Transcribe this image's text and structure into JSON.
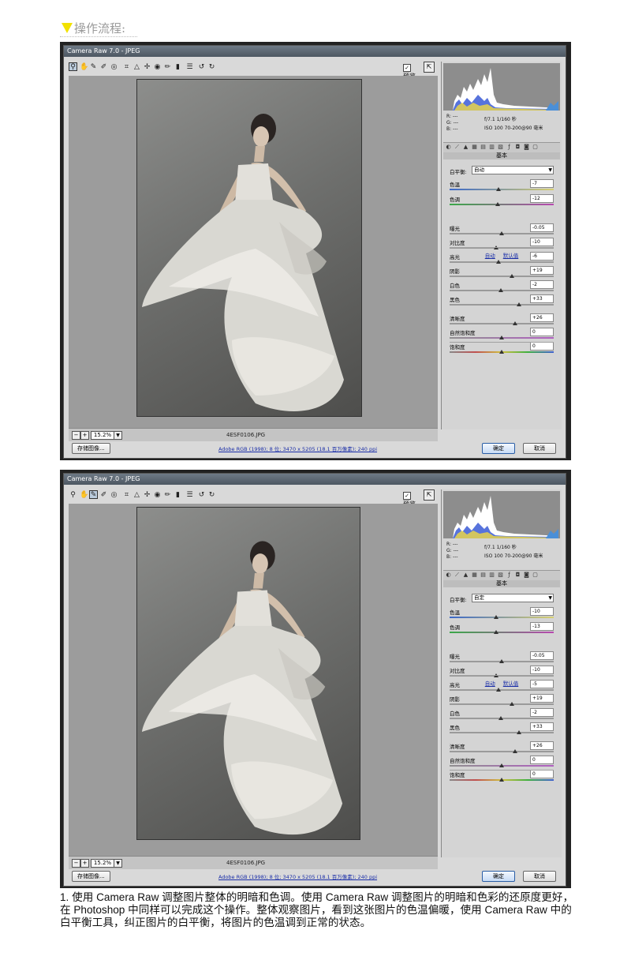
{
  "heading": "操作流程:",
  "screenshots": [
    {
      "title": "Camera Raw 7.0 - JPEG",
      "preview_label": "预览",
      "zoom": "15.2%",
      "filename": "4ESF0106.JPG",
      "workflow_link": "Adobe RGB (1998); 8 位; 3470 x 5205 (18.1 百万像素); 240 ppi",
      "save_button": "存储图像...",
      "ok_button": "确定",
      "cancel_button": "取消",
      "readout_r": "R:  ---",
      "readout_g": "G:  ---",
      "readout_b": "B:  ---",
      "camera_line1": "f/7.1   1/160 秒",
      "camera_line2": "ISO 100   70-200@90 毫米",
      "section": "基本",
      "wb_label": "白平衡:",
      "wb_value": "自动",
      "auto_link": "自动",
      "default_link": "默认值",
      "sliders": [
        {
          "label": "色温",
          "value": "-7",
          "level": 0.47
        },
        {
          "label": "色调",
          "value": "-12",
          "level": 0.46
        },
        {
          "label": "曝光",
          "value": "-0.05",
          "level": 0.5
        },
        {
          "label": "对比度",
          "value": "-10",
          "level": 0.45
        },
        {
          "label": "高光",
          "value": "-6",
          "level": 0.47
        },
        {
          "label": "阴影",
          "value": "+19",
          "level": 0.6
        },
        {
          "label": "白色",
          "value": "-2",
          "level": 0.49
        },
        {
          "label": "黑色",
          "value": "+33",
          "level": 0.67
        },
        {
          "label": "清晰度",
          "value": "+26",
          "level": 0.63
        },
        {
          "label": "自然饱和度",
          "value": "0",
          "level": 0.5
        },
        {
          "label": "饱和度",
          "value": "0",
          "level": 0.5
        }
      ]
    },
    {
      "title": "Camera Raw 7.0 - JPEG",
      "preview_label": "预览",
      "zoom": "15.2%",
      "filename": "4ESF0106.JPG",
      "workflow_link": "Adobe RGB (1998); 8 位; 3470 x 5205 (18.1 百万像素); 240 ppi",
      "save_button": "存储图像...",
      "ok_button": "确定",
      "cancel_button": "取消",
      "readout_r": "R:  ---",
      "readout_g": "G:  ---",
      "readout_b": "B:  ---",
      "camera_line1": "f/7.1   1/160 秒",
      "camera_line2": "ISO 100   70-200@90 毫米",
      "section": "基本",
      "wb_label": "白平衡:",
      "wb_value": "自定",
      "auto_link": "自动",
      "default_link": "默认值",
      "sliders": [
        {
          "label": "色温",
          "value": "-10",
          "level": 0.45
        },
        {
          "label": "色调",
          "value": "-13",
          "level": 0.45
        },
        {
          "label": "曝光",
          "value": "-0.05",
          "level": 0.5
        },
        {
          "label": "对比度",
          "value": "-10",
          "level": 0.45
        },
        {
          "label": "高光",
          "value": "-5",
          "level": 0.47
        },
        {
          "label": "阴影",
          "value": "+19",
          "level": 0.6
        },
        {
          "label": "白色",
          "value": "-2",
          "level": 0.49
        },
        {
          "label": "黑色",
          "value": "+33",
          "level": 0.67
        },
        {
          "label": "清晰度",
          "value": "+26",
          "level": 0.63
        },
        {
          "label": "自然饱和度",
          "value": "0",
          "level": 0.5
        },
        {
          "label": "饱和度",
          "value": "0",
          "level": 0.5
        }
      ]
    }
  ],
  "caption": "1. 使用 Camera Raw 调整图片整体的明暗和色调。使用 Camera Raw 调整图片的明暗和色彩的还原度更好，在 Photoshop 中同样可以完成这个操作。整体观察图片，看到这张图片的色温偏暖，使用 Camera Raw 中的白平衡工具，纠正图片的白平衡，将图片的色温调到正常的状态。",
  "icons": [
    "zoom-icon",
    "hand-icon",
    "white-balance-icon",
    "color-sampler-icon",
    "target-adjust-icon",
    "crop-icon",
    "straighten-icon",
    "spot-removal-icon",
    "red-eye-icon",
    "adjustment-brush-icon",
    "graduated-filter-icon",
    "preferences-icon",
    "rotate-left-icon",
    "rotate-right-icon"
  ],
  "colors": {
    "selected_tool": "#bbccdd",
    "link": "#1a2ea8",
    "heading_marker": "#f2e100"
  }
}
